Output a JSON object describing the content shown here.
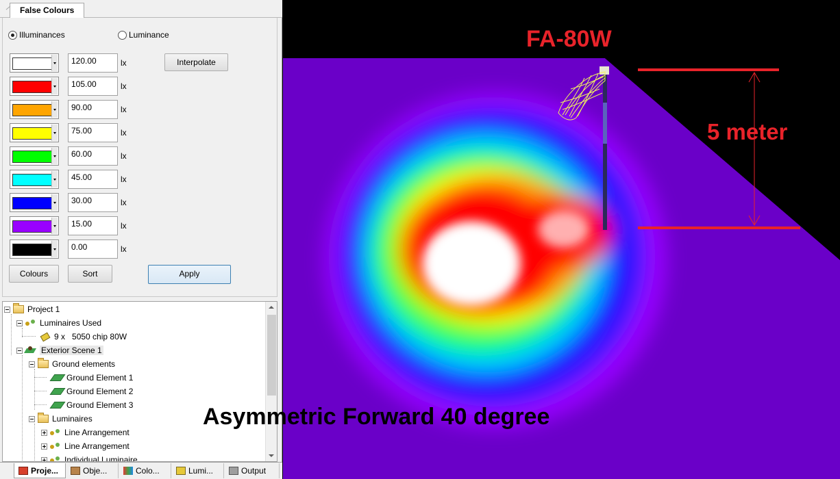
{
  "panel": {
    "tab_title": "False Colours",
    "radio_illuminances": "Illuminances",
    "radio_luminance": "Luminance",
    "selected_mode": "Illuminances",
    "interpolate": "Interpolate",
    "colours_btn": "Colours",
    "sort_btn": "Sort",
    "apply_btn": "Apply",
    "scale": [
      {
        "color": "#ffffff",
        "value": "120.00",
        "unit": "lx"
      },
      {
        "color": "#ff0000",
        "value": "105.00",
        "unit": "lx"
      },
      {
        "color": "#ffa500",
        "value": "90.00",
        "unit": "lx"
      },
      {
        "color": "#ffff00",
        "value": "75.00",
        "unit": "lx"
      },
      {
        "color": "#00ff00",
        "value": "60.00",
        "unit": "lx"
      },
      {
        "color": "#00ffff",
        "value": "45.00",
        "unit": "lx"
      },
      {
        "color": "#0000ff",
        "value": "30.00",
        "unit": "lx"
      },
      {
        "color": "#9900ff",
        "value": "15.00",
        "unit": "lx"
      },
      {
        "color": "#000000",
        "value": "0.00",
        "unit": "lx"
      }
    ]
  },
  "tree": {
    "project": "Project 1",
    "luminaires_used": "Luminaires Used",
    "luminaire_count": "9 x",
    "luminaire_name": "5050 chip 80W",
    "exterior_scene": "Exterior Scene 1",
    "ground_elements": "Ground elements",
    "ground_1": "Ground Element 1",
    "ground_2": "Ground Element 2",
    "ground_3": "Ground Element 3",
    "luminaires": "Luminaires",
    "line_arr_1": "Line Arrangement",
    "line_arr_2": "Line Arrangement",
    "individual": "Individual Luminaire"
  },
  "bottom_tabs": [
    {
      "label": "Proje...",
      "icon": "project-icon",
      "active": true
    },
    {
      "label": "Obje...",
      "icon": "objects-icon",
      "active": false
    },
    {
      "label": "Colo...",
      "icon": "colours-icon",
      "active": false
    },
    {
      "label": "Lumi...",
      "icon": "luminaire-icon",
      "active": false
    },
    {
      "label": "Output",
      "icon": "printer-icon",
      "active": false
    }
  ],
  "render": {
    "model_label": "FA-80W",
    "height_label": "5 meter",
    "caption": "Asymmetric Forward 40 degree",
    "annotation_color": "#e8232a"
  }
}
